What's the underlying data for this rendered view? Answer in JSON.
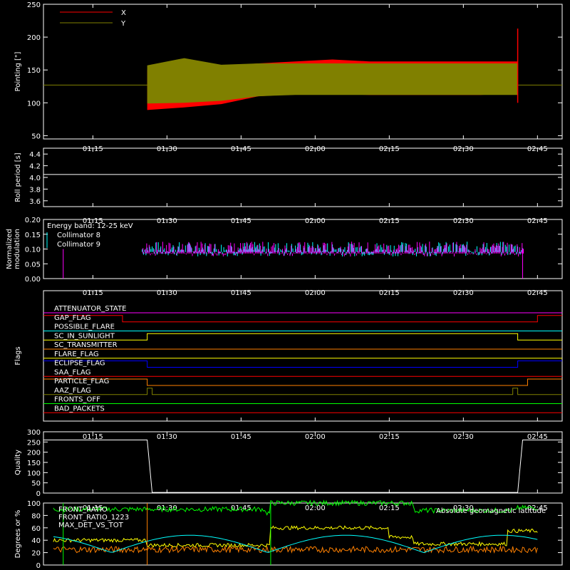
{
  "chart_data": [
    {
      "type": "line",
      "ylabel": "Pointing [\"]",
      "ylim": [
        45,
        250
      ],
      "yticks": [
        "50",
        "100",
        "150",
        "200",
        "250"
      ],
      "xticks": [
        "01:15",
        "01:30",
        "01:45",
        "02:00",
        "02:15",
        "02:30",
        "02:45"
      ],
      "legend": [
        "X",
        "Y"
      ],
      "series": [
        {
          "name": "X",
          "color": "#ff0000",
          "band_low": [
            89,
            93,
            98,
            110,
            113,
            113,
            112,
            112,
            112,
            112,
            115
          ],
          "band_high": [
            150,
            150,
            156,
            160,
            163,
            166,
            163,
            163,
            163,
            163,
            163
          ],
          "spike": 213
        },
        {
          "name": "Y",
          "color": "#808000",
          "band_low": [
            99,
            100,
            103,
            110,
            112,
            112,
            112,
            112,
            112,
            112,
            112
          ],
          "band_high": [
            157,
            168,
            158,
            160,
            160,
            160,
            160,
            160,
            160,
            160,
            160
          ]
        }
      ],
      "baseline": 127,
      "time_markers": [
        "01:26",
        "02:41"
      ]
    },
    {
      "type": "line",
      "ylabel": "Roll period [s]",
      "ylim": [
        3.5,
        4.5
      ],
      "yticks": [
        "3.6",
        "3.8",
        "4.0",
        "4.2",
        "4.4"
      ],
      "xticks": [
        "01:15",
        "01:30",
        "01:45",
        "02:00",
        "02:15",
        "02:30",
        "02:45"
      ],
      "series": [
        {
          "name": "",
          "color": "#ffffff",
          "value": 4.05
        }
      ]
    },
    {
      "type": "line",
      "ylabel": "Normalized modulation",
      "ylim": [
        0.0,
        0.2
      ],
      "yticks": [
        "0.00",
        "0.05",
        "0.10",
        "0.15",
        "0.20"
      ],
      "xticks": [
        "01:15",
        "01:30",
        "01:45",
        "02:00",
        "02:15",
        "02:30",
        "02:45"
      ],
      "annotation": "Energy band: 12-25 keV",
      "series": [
        {
          "name": "Collimator 8",
          "color": "#00ffff",
          "mean": 0.1
        },
        {
          "name": "Collimator 9",
          "color": "#ff00ff",
          "mean": 0.1
        }
      ]
    },
    {
      "type": "line",
      "ylabel": "Flags",
      "xticks": [
        "01:15",
        "01:30",
        "01:45",
        "02:00",
        "02:15",
        "02:30",
        "02:45"
      ],
      "flags": [
        {
          "name": "ATTENUATOR_STATE",
          "color": "#ff00ff"
        },
        {
          "name": "GAP_FLAG",
          "color": "#ff0000"
        },
        {
          "name": "POSSIBLE_FLARE",
          "color": "#00ffff"
        },
        {
          "name": "SC_IN_SUNLIGHT",
          "color": "#ffff00"
        },
        {
          "name": "SC_TRANSMITTER",
          "color": "#ff8000"
        },
        {
          "name": "FLARE_FLAG",
          "color": "#ffff00"
        },
        {
          "name": "ECLIPSE_FLAG",
          "color": "#0000ff"
        },
        {
          "name": "SAA_FLAG",
          "color": "#ff0000"
        },
        {
          "name": "PARTICLE_FLAG",
          "color": "#ff8000"
        },
        {
          "name": "AAZ_FLAG",
          "color": "#808000"
        },
        {
          "name": "FRONTS_OFF",
          "color": "#00ff00"
        },
        {
          "name": "BAD_PACKETS",
          "color": "#ff0000"
        }
      ]
    },
    {
      "type": "line",
      "ylabel": "Quality",
      "ylim": [
        0,
        300
      ],
      "yticks": [
        "0",
        "50",
        "100",
        "150",
        "200",
        "250",
        "300"
      ],
      "xticks": [
        "01:15",
        "01:30",
        "01:45",
        "02:00",
        "02:15",
        "02:30",
        "02:45"
      ],
      "series": [
        {
          "name": "",
          "color": "#ffffff",
          "segments": [
            [
              "01:05",
              260
            ],
            [
              "01:26",
              260
            ],
            [
              "01:27",
              3
            ],
            [
              "02:41",
              3
            ],
            [
              "02:42",
              260
            ],
            [
              "02:50",
              260
            ]
          ]
        }
      ]
    },
    {
      "type": "line",
      "ylabel": "Degrees or %",
      "ylim": [
        0,
        100
      ],
      "yticks": [
        "0",
        "20",
        "40",
        "60",
        "80",
        "100"
      ],
      "annotation": "Absolute geomagnetic latitude",
      "series": [
        {
          "name": "FRONT_RATIO",
          "color": "#ffff00"
        },
        {
          "name": "FRONT_RATIO_1223",
          "color": "#00ff00"
        },
        {
          "name": "MAX_DET_VS_TOT",
          "color": "#ff8000"
        },
        {
          "name": "Absolute geomagnetic latitude",
          "color": "#00ffff"
        }
      ]
    }
  ],
  "colors": {
    "background": "#000000",
    "axes": "#ffffff"
  }
}
